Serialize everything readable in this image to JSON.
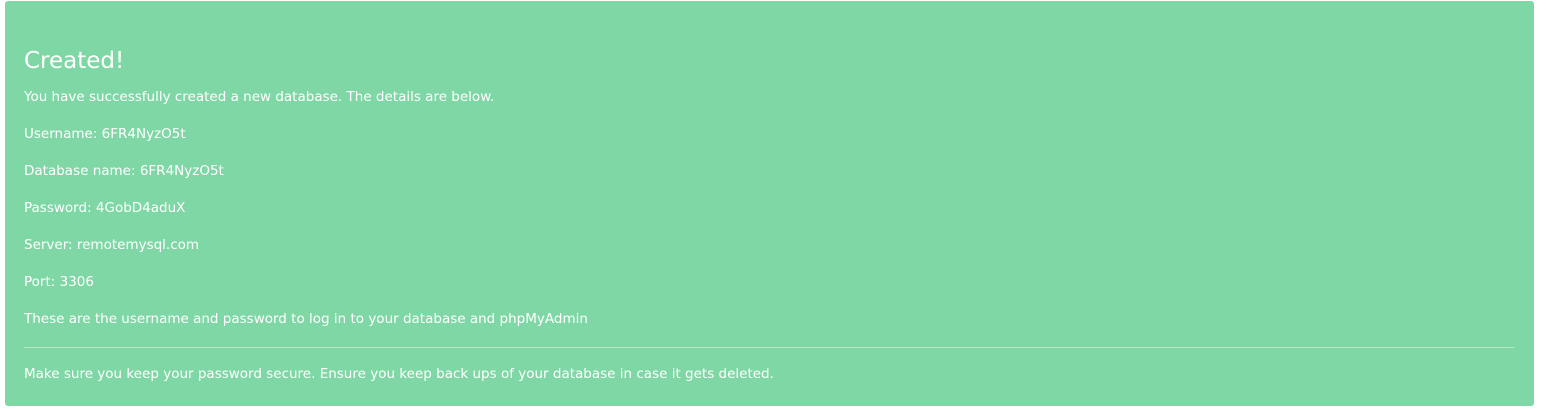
{
  "alert": {
    "title": "Created!",
    "intro": "You have successfully created a new database. The details are below.",
    "details": [
      "Username: 6FR4NyzO5t",
      "Database name: 6FR4NyzO5t",
      "Password: 4GobD4aduX",
      "Server: remotemysql.com",
      "Port: 3306"
    ],
    "note": "These are the username and password to log in to your database and phpMyAdmin",
    "footer": "Make sure you keep your password secure. Ensure you keep back ups of your database in case it gets deleted.",
    "background_color": "#7fd7a5",
    "text_color": "#ffffff"
  }
}
